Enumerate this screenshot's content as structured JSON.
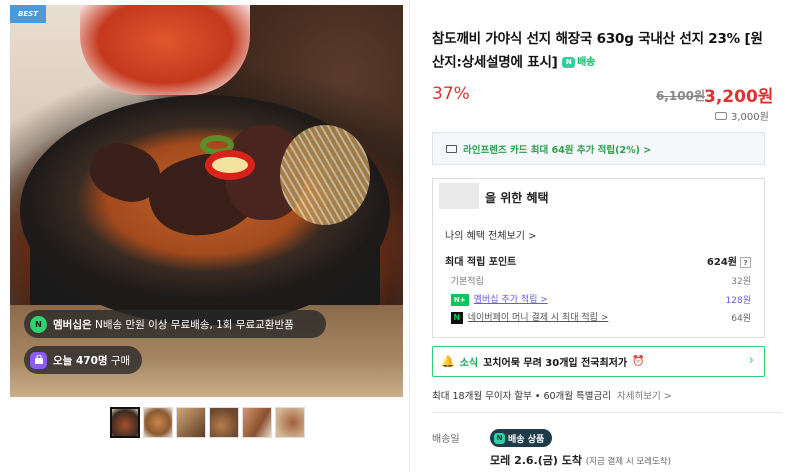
{
  "gallery": {
    "best_badge": "BEST",
    "chips": {
      "membership_icon": "N",
      "membership_strong": "멤버십은",
      "membership_text": " N배송 만원 이상 무료배송, 1회 무료교환반품",
      "buyers_strong": "오늘 470명",
      "buyers_text": " 구매"
    },
    "thumbnails_count": 6
  },
  "product": {
    "title": "참도깨비 가야식 선지 해장국 630g 국내산 선지 23% [원산지:상세설명에 표시]",
    "npay_badge": "배송",
    "discount": "37%",
    "original_price": "6,100원",
    "price": "3,200원",
    "alt_price": "3,000원"
  },
  "card_offer": {
    "text": "라인프렌즈 카드 최대 64원 추가 적립(2%) >"
  },
  "benefits": {
    "title": "을 위한 혜택",
    "view_all": "나의 혜택 전체보기 >",
    "max_points_label": "최대 적립 포인트",
    "max_points_value": "624원",
    "basic_label": "기본적립",
    "basic_value": "32원",
    "member_label": "멤버십 추가 적립 >",
    "member_value": "128원",
    "npay_label": "네이버페이 머니 결제 시 최대 적립 >",
    "npay_value": "64원"
  },
  "alert": {
    "green": "소식",
    "text": "꼬치어묵 무려 30개입 전국최저가",
    "emoji": "⏰"
  },
  "installment": {
    "text": "최대 18개월 무이자 할부 • 60개월 특별금리",
    "more": "자세히보기 >"
  },
  "shipping": {
    "label": "배송일",
    "badge": "배송 상품",
    "badge_icon": "N",
    "arrive": "모레 2.6.(금) 도착",
    "arrive_note": "(지금 결제 시 모레도착)"
  }
}
